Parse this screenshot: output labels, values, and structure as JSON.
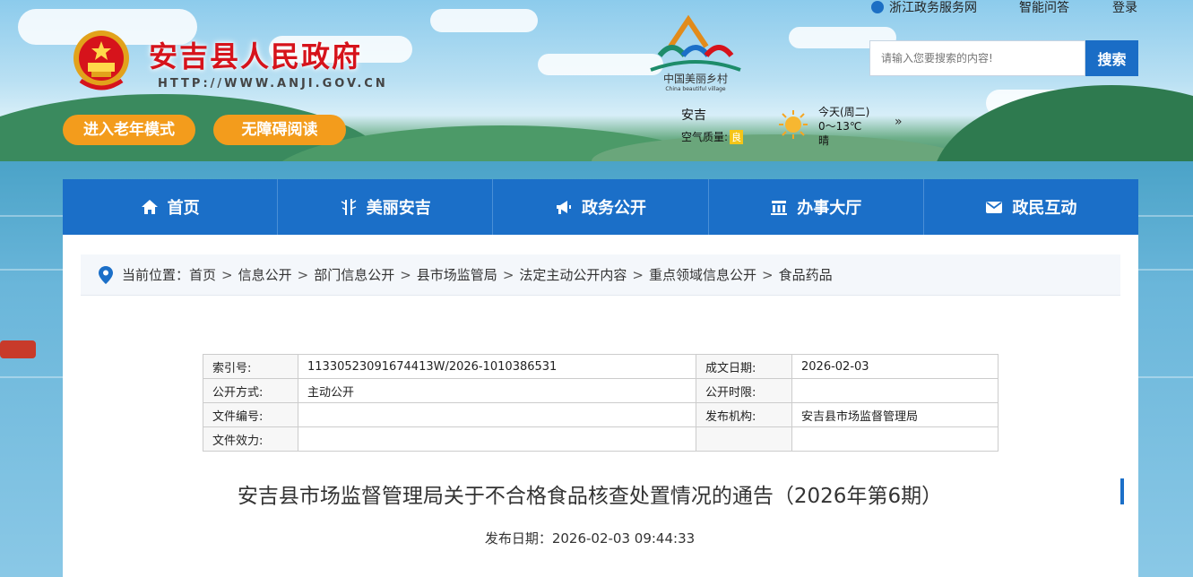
{
  "header": {
    "site_title": "安吉县人民政府",
    "site_url": "HTTP://WWW.ANJI.GOV.CN",
    "elder_mode_label": "进入老年模式",
    "accessible_label": "无障碍阅读",
    "top_links": {
      "service": "浙江政务服务网",
      "qa": "智能问答",
      "login": "登录"
    },
    "village_logo_text": "中国美丽乡村",
    "village_logo_sub": "China beautiful village",
    "search": {
      "placeholder": "请输入您要搜索的内容!",
      "button_label": "搜索"
    },
    "weather": {
      "city": "安吉",
      "air_quality_label": "空气质量:",
      "air_quality_value": "良",
      "day": "今天(周二)",
      "temp_range": "0～13℃",
      "condition": "晴",
      "more": "»"
    }
  },
  "nav": {
    "items": [
      {
        "label": "首页",
        "icon": "home-icon"
      },
      {
        "label": "美丽安吉",
        "icon": "bamboo-icon"
      },
      {
        "label": "政务公开",
        "icon": "megaphone-icon"
      },
      {
        "label": "办事大厅",
        "icon": "building-icon"
      },
      {
        "label": "政民互动",
        "icon": "mail-icon"
      }
    ]
  },
  "breadcrumb": {
    "label": "当前位置：",
    "items": [
      "首页",
      "信息公开",
      "部门信息公开",
      "县市场监管局",
      "法定主动公开内容",
      "重点领域信息公开",
      "食品药品"
    ]
  },
  "meta": {
    "index_no_label": "索引号:",
    "index_no": "11330523091674413W/2026-1010386531",
    "created_label": "成文日期:",
    "created": "2026-02-03",
    "open_method_label": "公开方式:",
    "open_method": "主动公开",
    "open_time_label": "公开时限:",
    "open_time": "",
    "doc_no_label": "文件编号:",
    "doc_no": "",
    "issuer_label": "发布机构:",
    "issuer": "安吉县市场监督管理局",
    "validity_label": "文件效力:",
    "validity": ""
  },
  "article": {
    "title": "安吉县市场监督管理局关于不合格食品核查处置情况的通告（2026年第6期）",
    "publish_date": "发布日期：2026-02-03 09:44:33"
  },
  "colors": {
    "brand_red": "#d6131b",
    "nav_blue": "#1b6fc8",
    "accent_orange": "#f39c1c"
  }
}
